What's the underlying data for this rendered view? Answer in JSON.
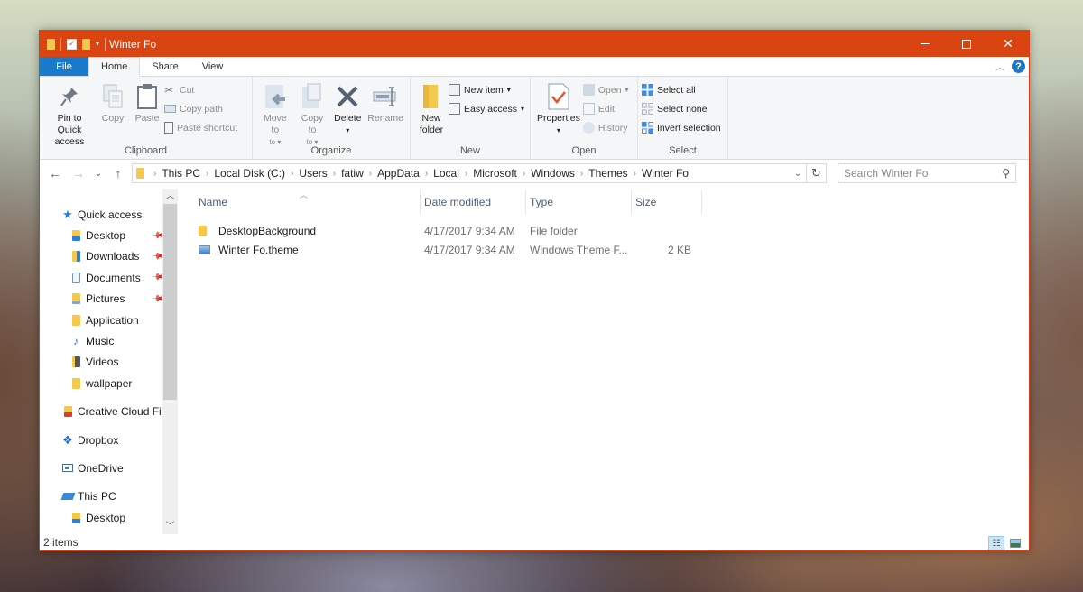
{
  "window": {
    "title": "Winter Fo",
    "accent_color": "#da4410",
    "controls": {
      "minimize": "minimize",
      "maximize": "maximize",
      "close": "✕"
    }
  },
  "ribbon_tabs": [
    {
      "label": "File"
    },
    {
      "label": "Home"
    },
    {
      "label": "Share"
    },
    {
      "label": "View"
    }
  ],
  "help_label": "?",
  "ribbon": {
    "clipboard": {
      "label": "Clipboard",
      "pin": "Pin to Quick access",
      "copy": "Copy",
      "paste": "Paste",
      "cut": "Cut",
      "copy_path": "Copy path",
      "paste_shortcut": "Paste shortcut"
    },
    "organize": {
      "label": "Organize",
      "move_to": "Move to",
      "copy_to": "Copy to",
      "delete": "Delete",
      "rename": "Rename"
    },
    "new": {
      "label": "New",
      "new_folder": "New folder",
      "new_item": "New item",
      "easy_access": "Easy access"
    },
    "open": {
      "label": "Open",
      "properties": "Properties",
      "open": "Open",
      "edit": "Edit",
      "history": "History"
    },
    "select": {
      "label": "Select",
      "select_all": "Select all",
      "select_none": "Select none",
      "invert": "Invert selection"
    }
  },
  "address": {
    "crumbs": [
      "This PC",
      "Local Disk (C:)",
      "Users",
      "fatiw",
      "AppData",
      "Local",
      "Microsoft",
      "Windows",
      "Themes",
      "Winter Fo"
    ],
    "search_placeholder": "Search Winter Fo"
  },
  "nav": {
    "quick_access": "Quick access",
    "quick_items": [
      {
        "label": "Desktop",
        "pinned": true
      },
      {
        "label": "Downloads",
        "pinned": true
      },
      {
        "label": "Documents",
        "pinned": true
      },
      {
        "label": "Pictures",
        "pinned": true
      },
      {
        "label": "Application",
        "pinned": false
      },
      {
        "label": "Music",
        "pinned": false
      },
      {
        "label": "Videos",
        "pinned": false
      },
      {
        "label": "wallpaper",
        "pinned": false
      }
    ],
    "creative_cloud": "Creative Cloud Files",
    "dropbox": "Dropbox",
    "onedrive": "OneDrive",
    "this_pc": "This PC",
    "this_pc_desktop": "Desktop"
  },
  "columns": {
    "name": "Name",
    "date": "Date modified",
    "type": "Type",
    "size": "Size"
  },
  "files": [
    {
      "name": "DesktopBackground",
      "date": "4/17/2017 9:34 AM",
      "type": "File folder",
      "size": "",
      "icon": "folder-icon"
    },
    {
      "name": "Winter Fo.theme",
      "date": "4/17/2017 9:34 AM",
      "type": "Windows Theme F...",
      "size": "2 KB",
      "icon": "theme-file-icon"
    }
  ],
  "status": {
    "items": "2 items"
  }
}
